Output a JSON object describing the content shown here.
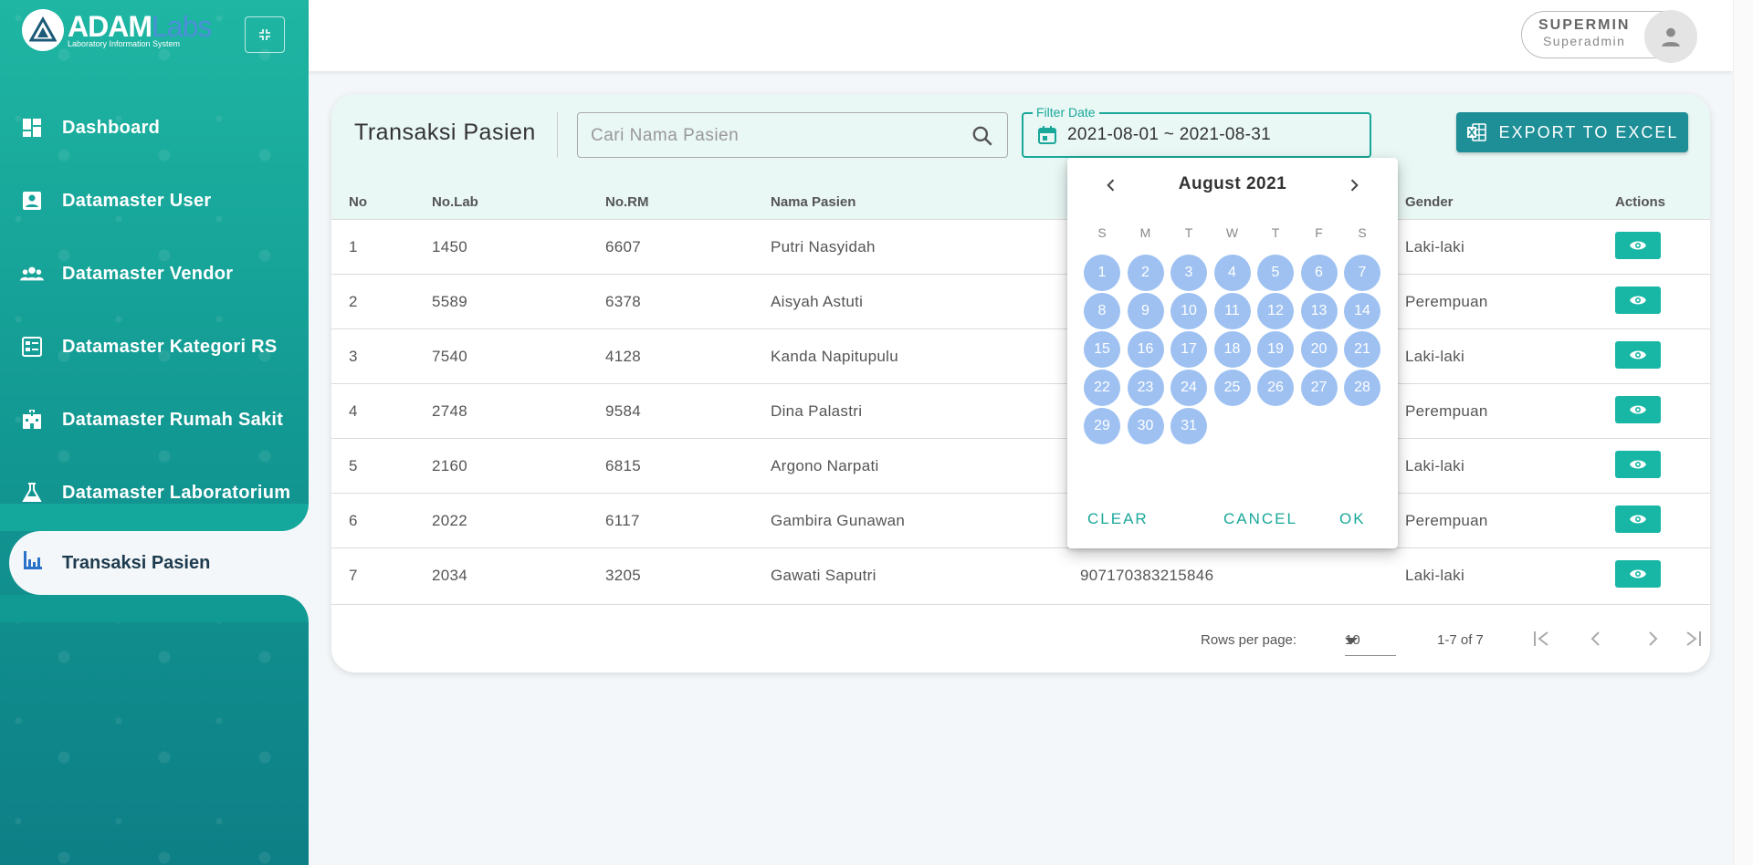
{
  "brand": {
    "name": "ADAM",
    "suffix": "Labs",
    "tagline": "Laboratory Information System"
  },
  "sidebar": {
    "items": [
      {
        "label": "Dashboard",
        "icon": "dashboard-icon"
      },
      {
        "label": "Datamaster User",
        "icon": "user-card-icon"
      },
      {
        "label": "Datamaster Vendor",
        "icon": "group-icon"
      },
      {
        "label": "Datamaster Kategori RS",
        "icon": "list-card-icon"
      },
      {
        "label": "Datamaster Rumah Sakit",
        "icon": "hospital-icon"
      },
      {
        "label": "Datamaster Laboratorium",
        "icon": "flask-icon"
      },
      {
        "label": "Transaksi Pasien",
        "icon": "bar-chart-icon",
        "active": true
      }
    ]
  },
  "header": {
    "user_name": "SUPERMIN",
    "user_role": "Superadmin"
  },
  "page": {
    "title": "Transaksi Pasien",
    "search_placeholder": "Cari Nama Pasien",
    "filter_label": "Filter Date",
    "filter_value": "2021-08-01 ~ 2021-08-31",
    "export_label": "EXPORT TO EXCEL"
  },
  "table": {
    "headers": [
      "No",
      "No.Lab",
      "No.RM",
      "Nama Pasien",
      "Gender",
      "Actions"
    ],
    "rows": [
      {
        "no": "1",
        "lab": "1450",
        "rm": "6607",
        "name": "Putri Nasyidah",
        "nik": "",
        "gender": "Laki-laki"
      },
      {
        "no": "2",
        "lab": "5589",
        "rm": "6378",
        "name": "Aisyah Astuti",
        "nik": "",
        "gender": "Perempuan"
      },
      {
        "no": "3",
        "lab": "7540",
        "rm": "4128",
        "name": "Kanda Napitupulu",
        "nik": "",
        "gender": "Laki-laki"
      },
      {
        "no": "4",
        "lab": "2748",
        "rm": "9584",
        "name": "Dina Palastri",
        "nik": "",
        "gender": "Perempuan"
      },
      {
        "no": "5",
        "lab": "2160",
        "rm": "6815",
        "name": "Argono Narpati",
        "nik": "",
        "gender": "Laki-laki"
      },
      {
        "no": "6",
        "lab": "2022",
        "rm": "6117",
        "name": "Gambira Gunawan",
        "nik": "",
        "gender": "Perempuan"
      },
      {
        "no": "7",
        "lab": "2034",
        "rm": "3205",
        "name": "Gawati Saputri",
        "nik": "907170383215846",
        "gender": "Laki-laki"
      }
    ]
  },
  "pagination": {
    "rows_per_page_label": "Rows per page:",
    "rows_per_page": "10",
    "range": "1-7 of 7"
  },
  "datepicker": {
    "month": "August 2021",
    "weekdays": [
      "S",
      "M",
      "T",
      "W",
      "T",
      "F",
      "S"
    ],
    "days": [
      "1",
      "2",
      "3",
      "4",
      "5",
      "6",
      "7",
      "8",
      "9",
      "10",
      "11",
      "12",
      "13",
      "14",
      "15",
      "16",
      "17",
      "18",
      "19",
      "20",
      "21",
      "22",
      "23",
      "24",
      "25",
      "26",
      "27",
      "28",
      "29",
      "30",
      "31"
    ],
    "start_offset": 0,
    "clear_label": "CLEAR",
    "cancel_label": "CANCEL",
    "ok_label": "OK"
  },
  "colors": {
    "accent": "#1aa89a",
    "selected_day": "#9ec1f2",
    "export": "#1e8f97"
  }
}
